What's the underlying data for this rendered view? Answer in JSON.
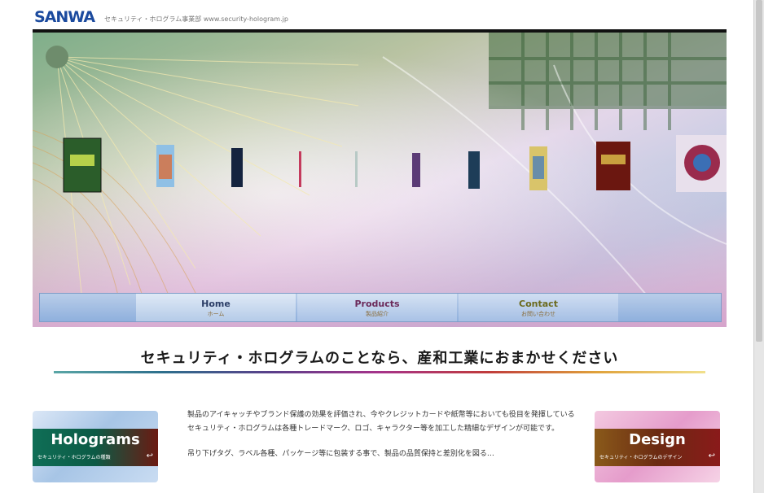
{
  "header": {
    "logo_text": "SANWA",
    "tagline": "セキュリティ・ホログラム事業部 www.security-hologram.jp"
  },
  "nav": {
    "home": {
      "label": "Home",
      "sub": "ホーム"
    },
    "products": {
      "label": "Products",
      "sub": "製品紹介"
    },
    "contact": {
      "label": "Contact",
      "sub": "お問い合わせ"
    }
  },
  "headline": "セキュリティ・ホログラムのことなら、産和工業におまかせください",
  "cards": {
    "holograms": {
      "title": "Holograms",
      "sub": "セキュリティ・ホログラムの種類"
    },
    "design": {
      "title": "Design",
      "sub": "セキュリティ・ホログラムのデザイン"
    }
  },
  "body": {
    "paragraph1": "製品のアイキャッチやブランド保護の効果を評価され、今やクレジットカードや紙幣等においても役目を発揮しているセキュリティ・ホログラムは各種トレードマーク、ロゴ、キャラクター等を加工した精細なデザインが可能です。",
    "paragraph2": "吊り下げタグ、ラベル各種、パッケージ等に包装する事で、製品の品質保持と差別化を図る…"
  },
  "colors": {
    "logo": "#1b4a9e",
    "nav_bg": "#a9c2e6",
    "holo_band": "#0f6e56",
    "design_band": "#8a1a1a"
  }
}
